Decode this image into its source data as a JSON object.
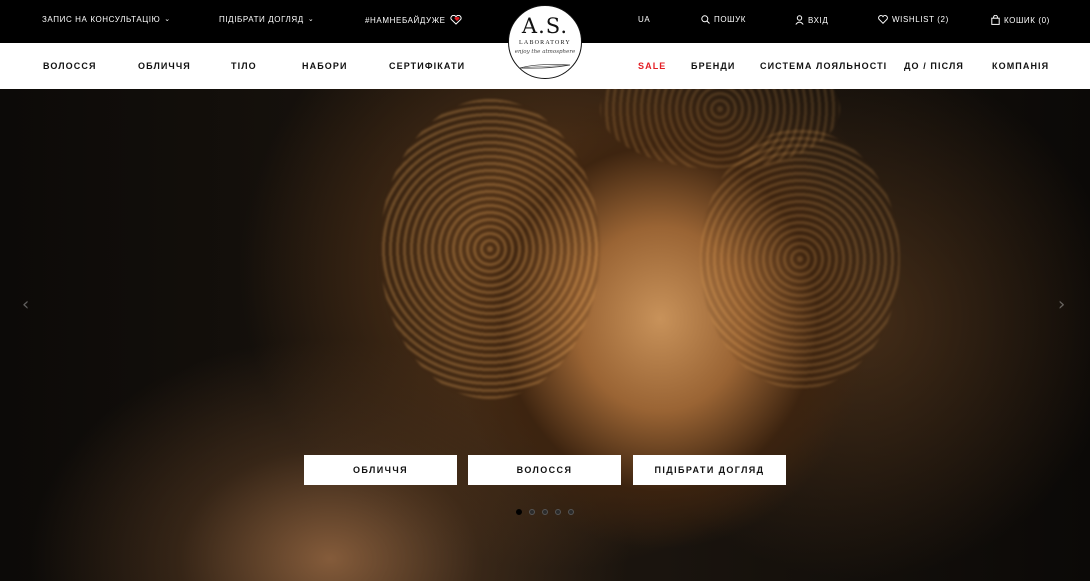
{
  "topbar": {
    "consultation": "Запис на консультацію",
    "pick_care": "Підібрати догляд",
    "hashtag": "#НАМНЕБАЙДУЖЕ",
    "lang": "UA",
    "search": "Пошук",
    "login": "Вхід",
    "wishlist": "Wishlist (2)",
    "cart": "Кошик (0)"
  },
  "logo": {
    "main": "A.S.",
    "sub": "Laboratory",
    "tagline": "enjoy the atmosphere"
  },
  "nav": {
    "items": [
      "Волосся",
      "Обличчя",
      "Тіло",
      "Набори",
      "Сертифікати",
      "Sale",
      "Бренди",
      "Система лояльності",
      "До / після",
      "Компанія"
    ]
  },
  "hero": {
    "buttons": [
      "Обличчя",
      "Волосся",
      "Підібрати догляд"
    ],
    "slide_count": 5,
    "active_slide": 1,
    "arrow_prev": "‹",
    "arrow_next": "›"
  },
  "colors": {
    "sale": "#e31e24",
    "heart": "#e31e24"
  }
}
